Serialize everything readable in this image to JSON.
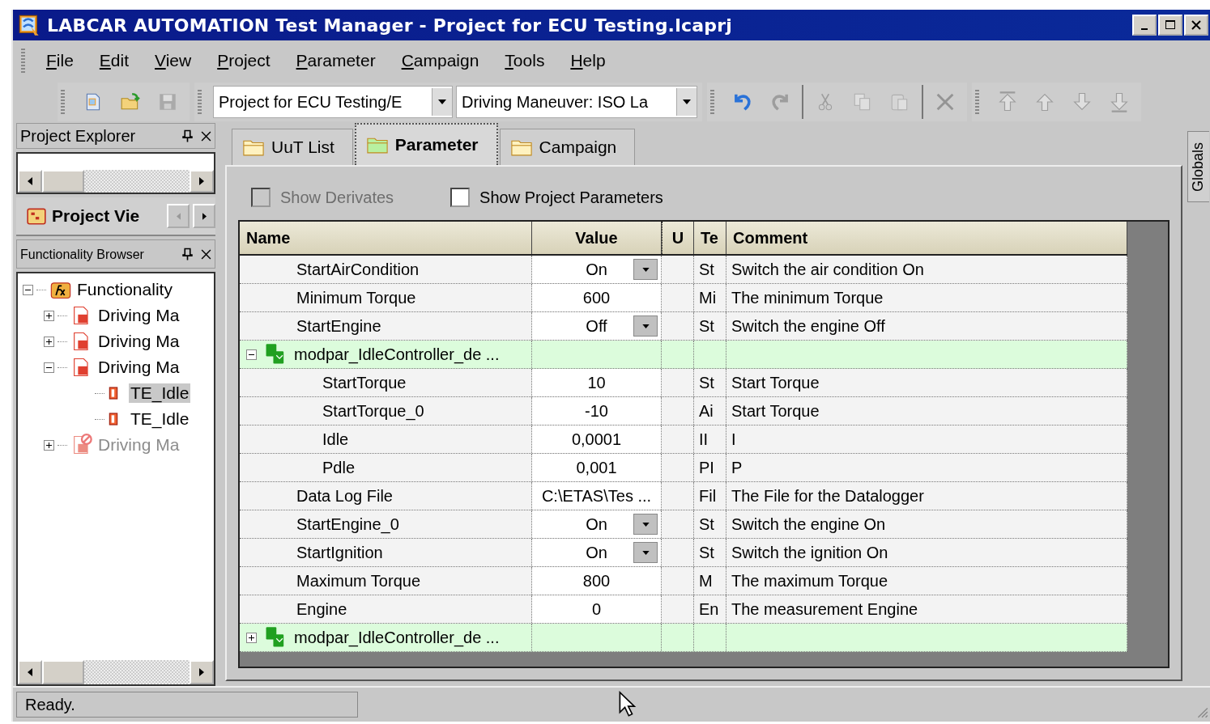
{
  "window": {
    "title": "LABCAR AUTOMATION Test Manager - Project for ECU Testing.lcaprj"
  },
  "menu": [
    {
      "label": "File"
    },
    {
      "label": "Edit"
    },
    {
      "label": "View"
    },
    {
      "label": "Project"
    },
    {
      "label": "Parameter"
    },
    {
      "label": "Campaign"
    },
    {
      "label": "Tools"
    },
    {
      "label": "Help"
    }
  ],
  "toolbar": {
    "file_buttons": [
      {
        "kind": "new",
        "disabled": false
      },
      {
        "kind": "open",
        "disabled": false
      },
      {
        "kind": "save",
        "disabled": true
      }
    ],
    "project_combo": "Project for ECU Testing/E",
    "maneuver_combo": "Driving Maneuver: ISO La",
    "edit_buttons": [
      {
        "kind": "undo",
        "disabled": false
      },
      {
        "kind": "redo",
        "disabled": true
      },
      {
        "kind": "sep"
      },
      {
        "kind": "cut",
        "disabled": true
      },
      {
        "kind": "copy",
        "disabled": true
      },
      {
        "kind": "paste",
        "disabled": true
      },
      {
        "kind": "sep"
      },
      {
        "kind": "delete",
        "disabled": true
      }
    ],
    "move_buttons": [
      {
        "kind": "top",
        "disabled": true
      },
      {
        "kind": "up",
        "disabled": true
      },
      {
        "kind": "down",
        "disabled": true
      },
      {
        "kind": "bottom",
        "disabled": true
      }
    ]
  },
  "project_explorer": {
    "title": "Project Explorer",
    "tab": "Project Vie"
  },
  "functionality_browser": {
    "title": "Functionality Browser",
    "tree": [
      {
        "label": "Functionality",
        "kind": "functionality",
        "selected": false,
        "disabled": false,
        "expanded": true,
        "children": [
          {
            "label": "Driving Ma",
            "kind": "maneuver",
            "selected": false,
            "disabled": false,
            "expanded": false
          },
          {
            "label": "Driving Ma",
            "kind": "maneuver",
            "selected": false,
            "disabled": false,
            "expanded": false
          },
          {
            "label": "Driving Ma",
            "kind": "maneuver",
            "selected": false,
            "disabled": false,
            "expanded": true,
            "children": [
              {
                "label": "TE_Idle",
                "kind": "test",
                "selected": true,
                "disabled": false
              },
              {
                "label": "TE_Idle",
                "kind": "test",
                "selected": false,
                "disabled": false
              }
            ]
          },
          {
            "label": "Driving Ma",
            "kind": "maneuver",
            "selected": false,
            "disabled": true,
            "expanded": false
          }
        ]
      }
    ]
  },
  "tabs": [
    {
      "label": "UuT List",
      "selected": false
    },
    {
      "label": "Parameter",
      "selected": true
    },
    {
      "label": "Campaign",
      "selected": false
    }
  ],
  "options": [
    {
      "label": "Show Derivates",
      "checked": false,
      "disabled": true
    },
    {
      "label": "Show Project Parameters",
      "checked": false,
      "disabled": false
    }
  ],
  "table": {
    "columns": [
      "Name",
      "Value",
      "U",
      "Te",
      "Comment"
    ],
    "rows": [
      {
        "kind": "param",
        "name": "StartAirCondition",
        "value": "On",
        "dropdown": true,
        "te": "St",
        "comment": "Switch the air condition On"
      },
      {
        "kind": "param",
        "name": "Minimum Torque",
        "value": "600",
        "dropdown": false,
        "te": "Mi",
        "comment": "The minimum Torque"
      },
      {
        "kind": "param",
        "name": "StartEngine",
        "value": "Off",
        "dropdown": true,
        "te": "St",
        "comment": "Switch the engine Off"
      },
      {
        "kind": "group",
        "name": "modpar_IdleController_de ...",
        "expanded": true,
        "children": [
          {
            "kind": "param",
            "name": "StartTorque",
            "value": "10",
            "dropdown": false,
            "te": "St",
            "comment": "Start Torque"
          },
          {
            "kind": "param",
            "name": "StartTorque_0",
            "value": "-10",
            "dropdown": false,
            "te": "Ai",
            "comment": "Start Torque"
          },
          {
            "kind": "param",
            "name": "Idle",
            "value": "0,0001",
            "dropdown": false,
            "te": "II",
            "comment": "I"
          },
          {
            "kind": "param",
            "name": "Pdle",
            "value": "0,001",
            "dropdown": false,
            "te": "PI",
            "comment": "P"
          }
        ]
      },
      {
        "kind": "param",
        "name": "Data Log File",
        "value": "C:\\ETAS\\Tes ...",
        "dropdown": false,
        "te": "Fil",
        "comment": "The File for the Datalogger"
      },
      {
        "kind": "param",
        "name": "StartEngine_0",
        "value": "On",
        "dropdown": true,
        "te": "St",
        "comment": "Switch the engine On"
      },
      {
        "kind": "param",
        "name": "StartIgnition",
        "value": "On",
        "dropdown": true,
        "te": "St",
        "comment": "Switch the ignition On"
      },
      {
        "kind": "param",
        "name": "Maximum Torque",
        "value": "800",
        "dropdown": false,
        "te": "M",
        "comment": "The maximum Torque"
      },
      {
        "kind": "param",
        "name": "Engine",
        "value": "0",
        "dropdown": false,
        "te": "En",
        "comment": "The measurement Engine"
      },
      {
        "kind": "group",
        "name": "modpar_IdleController_de ...",
        "expanded": false
      }
    ]
  },
  "side_tab": "Globals",
  "status_bar": {
    "text": "Ready."
  }
}
